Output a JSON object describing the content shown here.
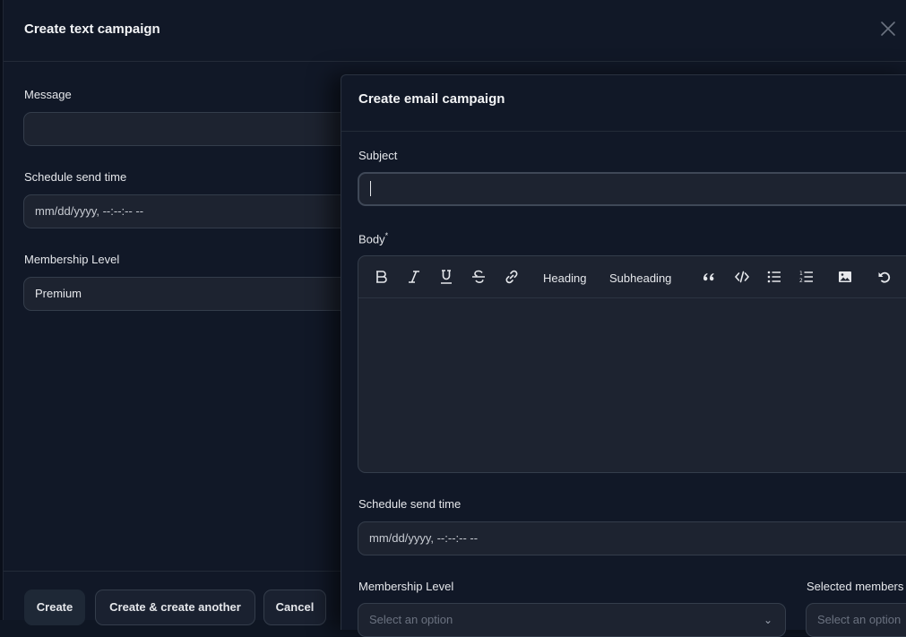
{
  "text_campaign": {
    "title": "Create text campaign",
    "fields": {
      "message": {
        "label": "Message",
        "value": ""
      },
      "schedule": {
        "label": "Schedule send time",
        "placeholder": "mm/dd/yyyy, --:--:-- --"
      },
      "membership": {
        "label": "Membership Level",
        "value": "Premium"
      }
    },
    "buttons": {
      "create": "Create",
      "create_another": "Create & create another",
      "cancel": "Cancel"
    }
  },
  "email_campaign": {
    "title": "Create email campaign",
    "fields": {
      "subject": {
        "label": "Subject",
        "value": ""
      },
      "body": {
        "label": "Body",
        "required_mark": "*"
      },
      "schedule": {
        "label": "Schedule send time",
        "placeholder": "mm/dd/yyyy, --:--:-- --"
      },
      "membership": {
        "label": "Membership Level",
        "placeholder": "Select an option"
      },
      "selected_members": {
        "label": "Selected members",
        "placeholder": "Select an option"
      }
    },
    "toolbar": {
      "bold": "bold-icon",
      "italic": "italic-icon",
      "underline": "underline-icon",
      "strike": "strikethrough-icon",
      "link": "link-icon",
      "heading": "Heading",
      "subheading": "Subheading",
      "quote": "quote-icon",
      "code": "code-icon",
      "bullet_list": "bullet-list-icon",
      "ordered_list": "ordered-list-icon",
      "image": "image-icon",
      "undo": "undo-icon"
    }
  }
}
